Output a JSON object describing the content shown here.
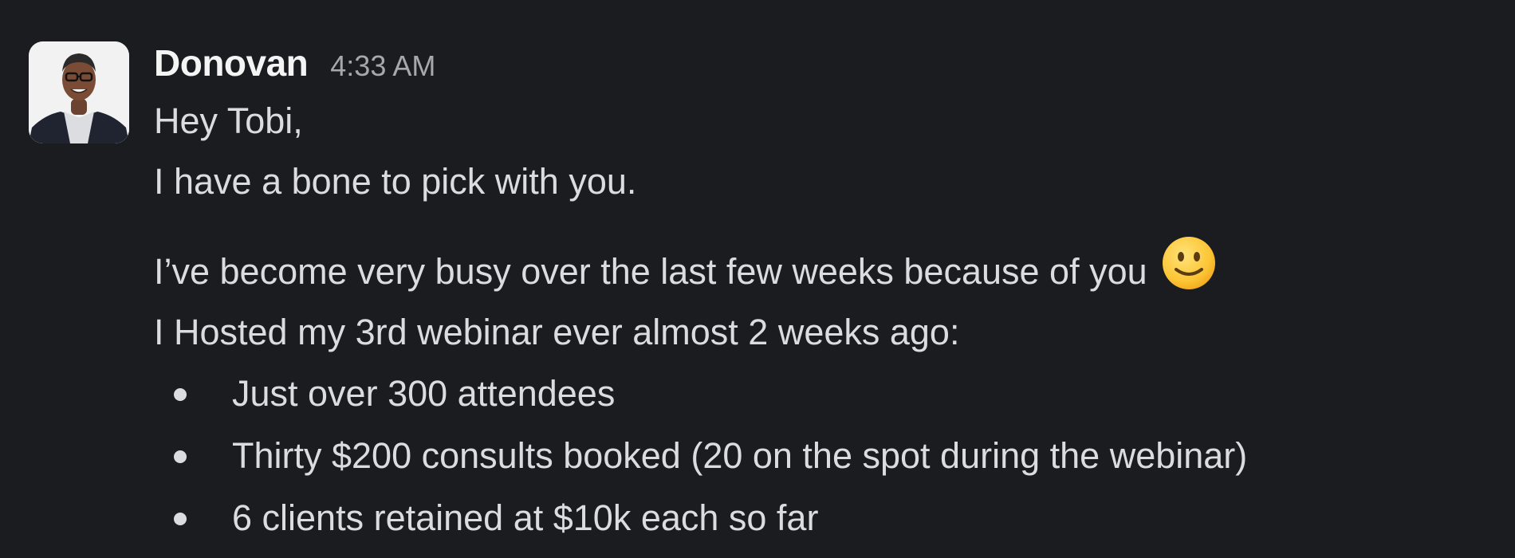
{
  "message": {
    "author": "Donovan",
    "timestamp": "4:33 AM",
    "avatar": "profile-photo",
    "lines": [
      "Hey Tobi,",
      "I have a bone to pick with you.",
      "I’ve become very busy over the last few weeks because of you",
      "I Hosted my 3rd webinar ever almost 2 weeks ago:"
    ],
    "emoji": "slightly-smiling-face",
    "bullets": [
      "Just over 300 attendees",
      "Thirty $200 consults booked (20 on the spot during the webinar)",
      "6 clients retained at $10k each so far"
    ]
  },
  "colors": {
    "background": "#1b1c20",
    "text": "#dcdcde",
    "author": "#f4f4f5",
    "timestamp": "#a7a8ab"
  }
}
